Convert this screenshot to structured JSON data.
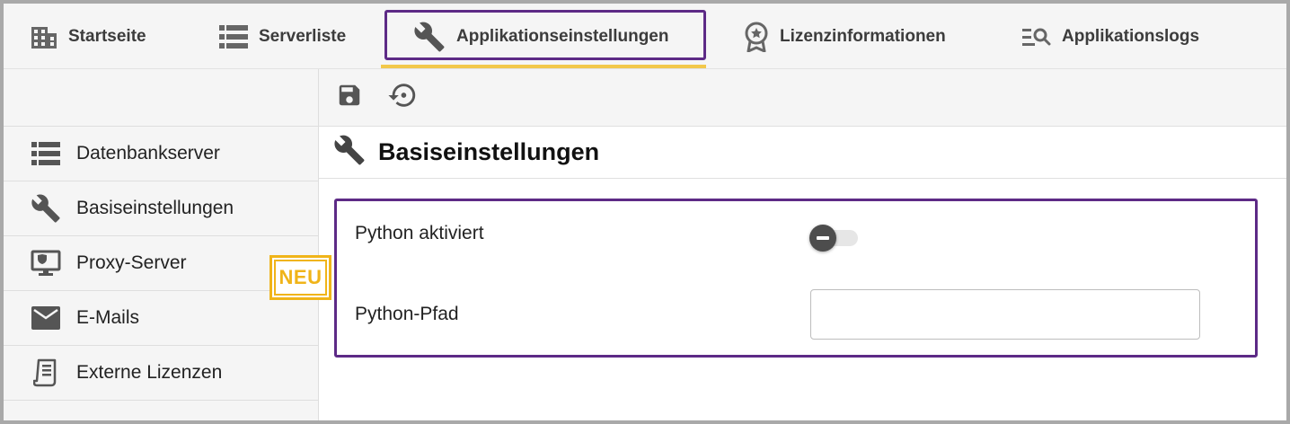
{
  "nav": {
    "tabs": [
      {
        "label": "Startseite",
        "icon": "building-icon"
      },
      {
        "label": "Serverliste",
        "icon": "server-list-icon"
      },
      {
        "label": "Applikationseinstellungen",
        "icon": "wrench-icon",
        "active": true
      },
      {
        "label": "Lizenzinformationen",
        "icon": "award-badge-icon"
      },
      {
        "label": "Applikationslogs",
        "icon": "log-search-icon"
      }
    ]
  },
  "sidebar": {
    "items": [
      {
        "label": "Datenbankserver",
        "icon": "server-list-icon"
      },
      {
        "label": "Basiseinstellungen",
        "icon": "wrench-icon"
      },
      {
        "label": "Proxy-Server",
        "icon": "monitor-shield-icon"
      },
      {
        "label": "E-Mails",
        "icon": "envelope-icon"
      },
      {
        "label": "Externe Lizenzen",
        "icon": "certificate-document-icon"
      }
    ]
  },
  "toolbar": {
    "buttons": [
      "save-icon",
      "restore-history-icon"
    ]
  },
  "section": {
    "title": "Basiseinstellungen",
    "icon": "wrench-icon"
  },
  "settings": {
    "python_enabled_label": "Python aktiviert",
    "python_enabled_value": false,
    "python_path_label": "Python-Pfad",
    "python_path_value": ""
  },
  "badge": {
    "text": "NEU",
    "color": "#f0b419"
  },
  "colors": {
    "highlight_border": "#5d2a86",
    "active_underline": "#f2c84b",
    "icon_gray": "#555555"
  }
}
